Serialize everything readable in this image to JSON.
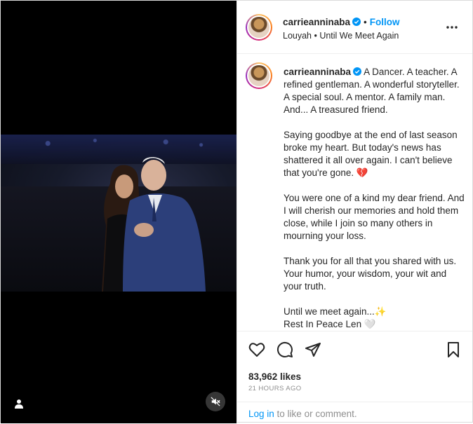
{
  "header": {
    "username": "carrieanninaba",
    "separator": "•",
    "follow_label": "Follow",
    "audio": "Louyah • Until We Meet Again",
    "more_icon": "more-horizontal-icon"
  },
  "caption": {
    "username": "carrieanninaba",
    "paragraphs": [
      "A Dancer. A teacher. A refined gentleman. A wonderful storyteller. A special soul. A mentor. A family man. And... A treasured friend.",
      "Saying goodbye at the end of last season broke my heart. But today's news has shattered it all over again. I can't believe that you're gone. 💔",
      "You were one of a kind my dear friend. And I will cherish our memories and hold them close, while I join so many others in mourning your loss.",
      "Thank you for all that you shared with us. Your humor, your wisdom, your wit and your truth.",
      "Until we meet again...✨",
      "Rest In Peace Len 🤍"
    ]
  },
  "actions": {
    "like_icon": "heart-icon",
    "comment_icon": "comment-icon",
    "share_icon": "paper-plane-icon",
    "save_icon": "bookmark-icon"
  },
  "likes": "83,962 likes",
  "timestamp": "21 HOURS AGO",
  "comment_bar": {
    "login_label": "Log in",
    "suffix": " to like or comment."
  },
  "media": {
    "tag_icon": "person-tag-icon",
    "mute_icon": "muted-speaker-icon"
  },
  "colors": {
    "link_blue": "#0095f6",
    "border": "#dbdbdb",
    "text": "#262626",
    "secondary": "#8e8e8e"
  }
}
